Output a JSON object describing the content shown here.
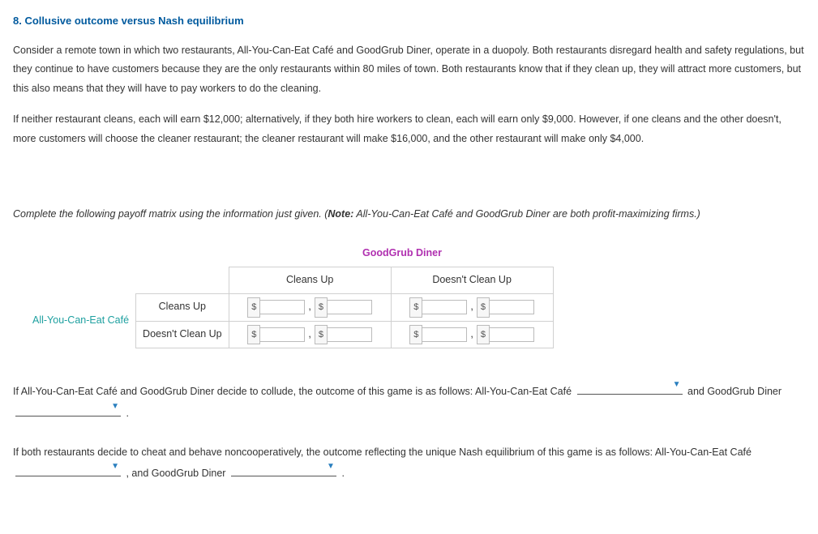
{
  "title": "8. Collusive outcome versus Nash equilibrium",
  "para1": "Consider a remote town in which two restaurants, All-You-Can-Eat Café and GoodGrub Diner, operate in a duopoly. Both restaurants disregard health and safety regulations, but they continue to have customers because they are the only restaurants within 80 miles of town. Both restaurants know that if they clean up, they will attract more customers, but this also means that they will have to pay workers to do the cleaning.",
  "para2": "If neither restaurant cleans, each will earn $12,000; alternatively, if they both hire workers to clean, each will earn only $9,000. However, if one cleans and the other doesn't, more customers will choose the cleaner restaurant; the cleaner restaurant will make $16,000, and the other restaurant will make only $4,000.",
  "instr_pre": "Complete the following payoff matrix using the information just given. (",
  "instr_note_label": "Note:",
  "instr_post": " All-You-Can-Eat Café and GoodGrub Diner are both profit-maximizing firms.)",
  "matrix": {
    "col_player": "GoodGrub Diner",
    "row_player": "All-You-Can-Eat Café",
    "col_labels": [
      "Cleans Up",
      "Doesn't Clean Up"
    ],
    "row_labels": [
      "Cleans Up",
      "Doesn't Clean Up"
    ],
    "currency": "$"
  },
  "s1": {
    "a": "If All-You-Can-Eat Café and GoodGrub Diner decide to collude, the outcome of this game is as follows: All-You-Can-Eat Café ",
    "b": " and GoodGrub Diner ",
    "c": " ."
  },
  "s2": {
    "a": "If both restaurants decide to cheat and behave noncooperatively, the outcome reflecting the unique Nash equilibrium of this game is as follows: All-You-Can-Eat Café ",
    "b": " , and GoodGrub Diner ",
    "c": " ."
  }
}
